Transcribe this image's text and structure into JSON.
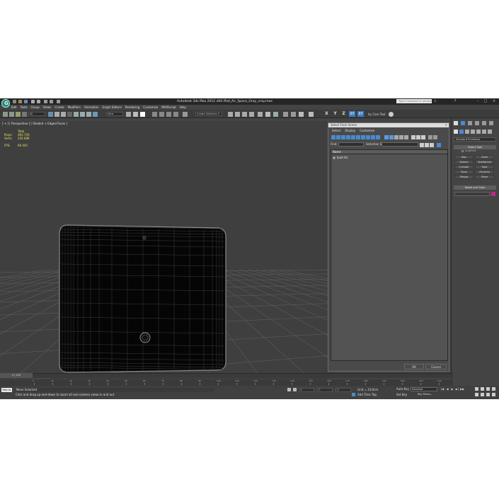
{
  "titlebar": {
    "logo": "3ds-max-logo",
    "title": "Autodesk 3ds Max  2012 x64    iPad_Air_Space_Gray_vray.max",
    "search_placeholder": "Type a keyword or phrase"
  },
  "menubar": [
    "Edit",
    "Tools",
    "Group",
    "Views",
    "Create",
    "Modifiers",
    "Animation",
    "Graph Editors",
    "Rendering",
    "Customize",
    "MAXScript",
    "Help"
  ],
  "toolbar": {
    "filter_dropdown": "All",
    "refcoord_dropdown": "View",
    "selset_dropdown": "Create Selection S",
    "axes": [
      "X",
      "Y",
      "Z",
      "XY",
      "XY"
    ],
    "tool_label": "ity Cam Tool"
  },
  "viewport": {
    "label": "[ + ] [ Perspective ] [ Shaded + Edged Faces ]",
    "stats": {
      "header": "Total",
      "rows": [
        {
          "label": "Polys:",
          "value": "483 729"
        },
        {
          "label": "Verts:",
          "value": "236 689"
        }
      ],
      "fps_label": "FPS:",
      "fps_value": "69.445"
    }
  },
  "dialog": {
    "title": "Select From Scene",
    "close": "×",
    "menu": [
      "Select",
      "Display",
      "Customize"
    ],
    "find_label": "Find:",
    "selection_set_label": "Selection Set:",
    "list_header": "Name",
    "items": [
      "Ipad Air"
    ],
    "ok": "OK",
    "cancel": "Cancel"
  },
  "command_panel": {
    "category_dropdown": "Standard Primitives",
    "object_type_rollout": "Object Type",
    "autogrid": "AutoGrid",
    "primitives": [
      "Box",
      "Cone",
      "Sphere",
      "GeoSphere",
      "Cylinder",
      "Tube",
      "Torus",
      "Pyramid",
      "Teapot",
      "Plane"
    ],
    "name_color_rollout": "Name and Color",
    "color": "#c62585"
  },
  "timeline": {
    "slider": "0 / 225",
    "ticks": [
      "0",
      "10",
      "20",
      "30",
      "40",
      "50",
      "60",
      "70",
      "80",
      "90",
      "100",
      "110",
      "120",
      "130",
      "140",
      "150",
      "160",
      "170",
      "180",
      "190",
      "200",
      "210",
      "220"
    ]
  },
  "status": {
    "maxscript": "Max to",
    "primary": "None Selected",
    "prompt": "Click and drag up-and-down to zoom all non-camera views in and out",
    "x": "X:",
    "y": "Y:",
    "z": "Z:",
    "grid": "Grid = 10,0cm",
    "add_time_tag": "Add Time Tag",
    "auto_key": "Auto Key",
    "selected": "Selected",
    "set_key": "Set Key",
    "key_filters": "Key Filters..."
  }
}
